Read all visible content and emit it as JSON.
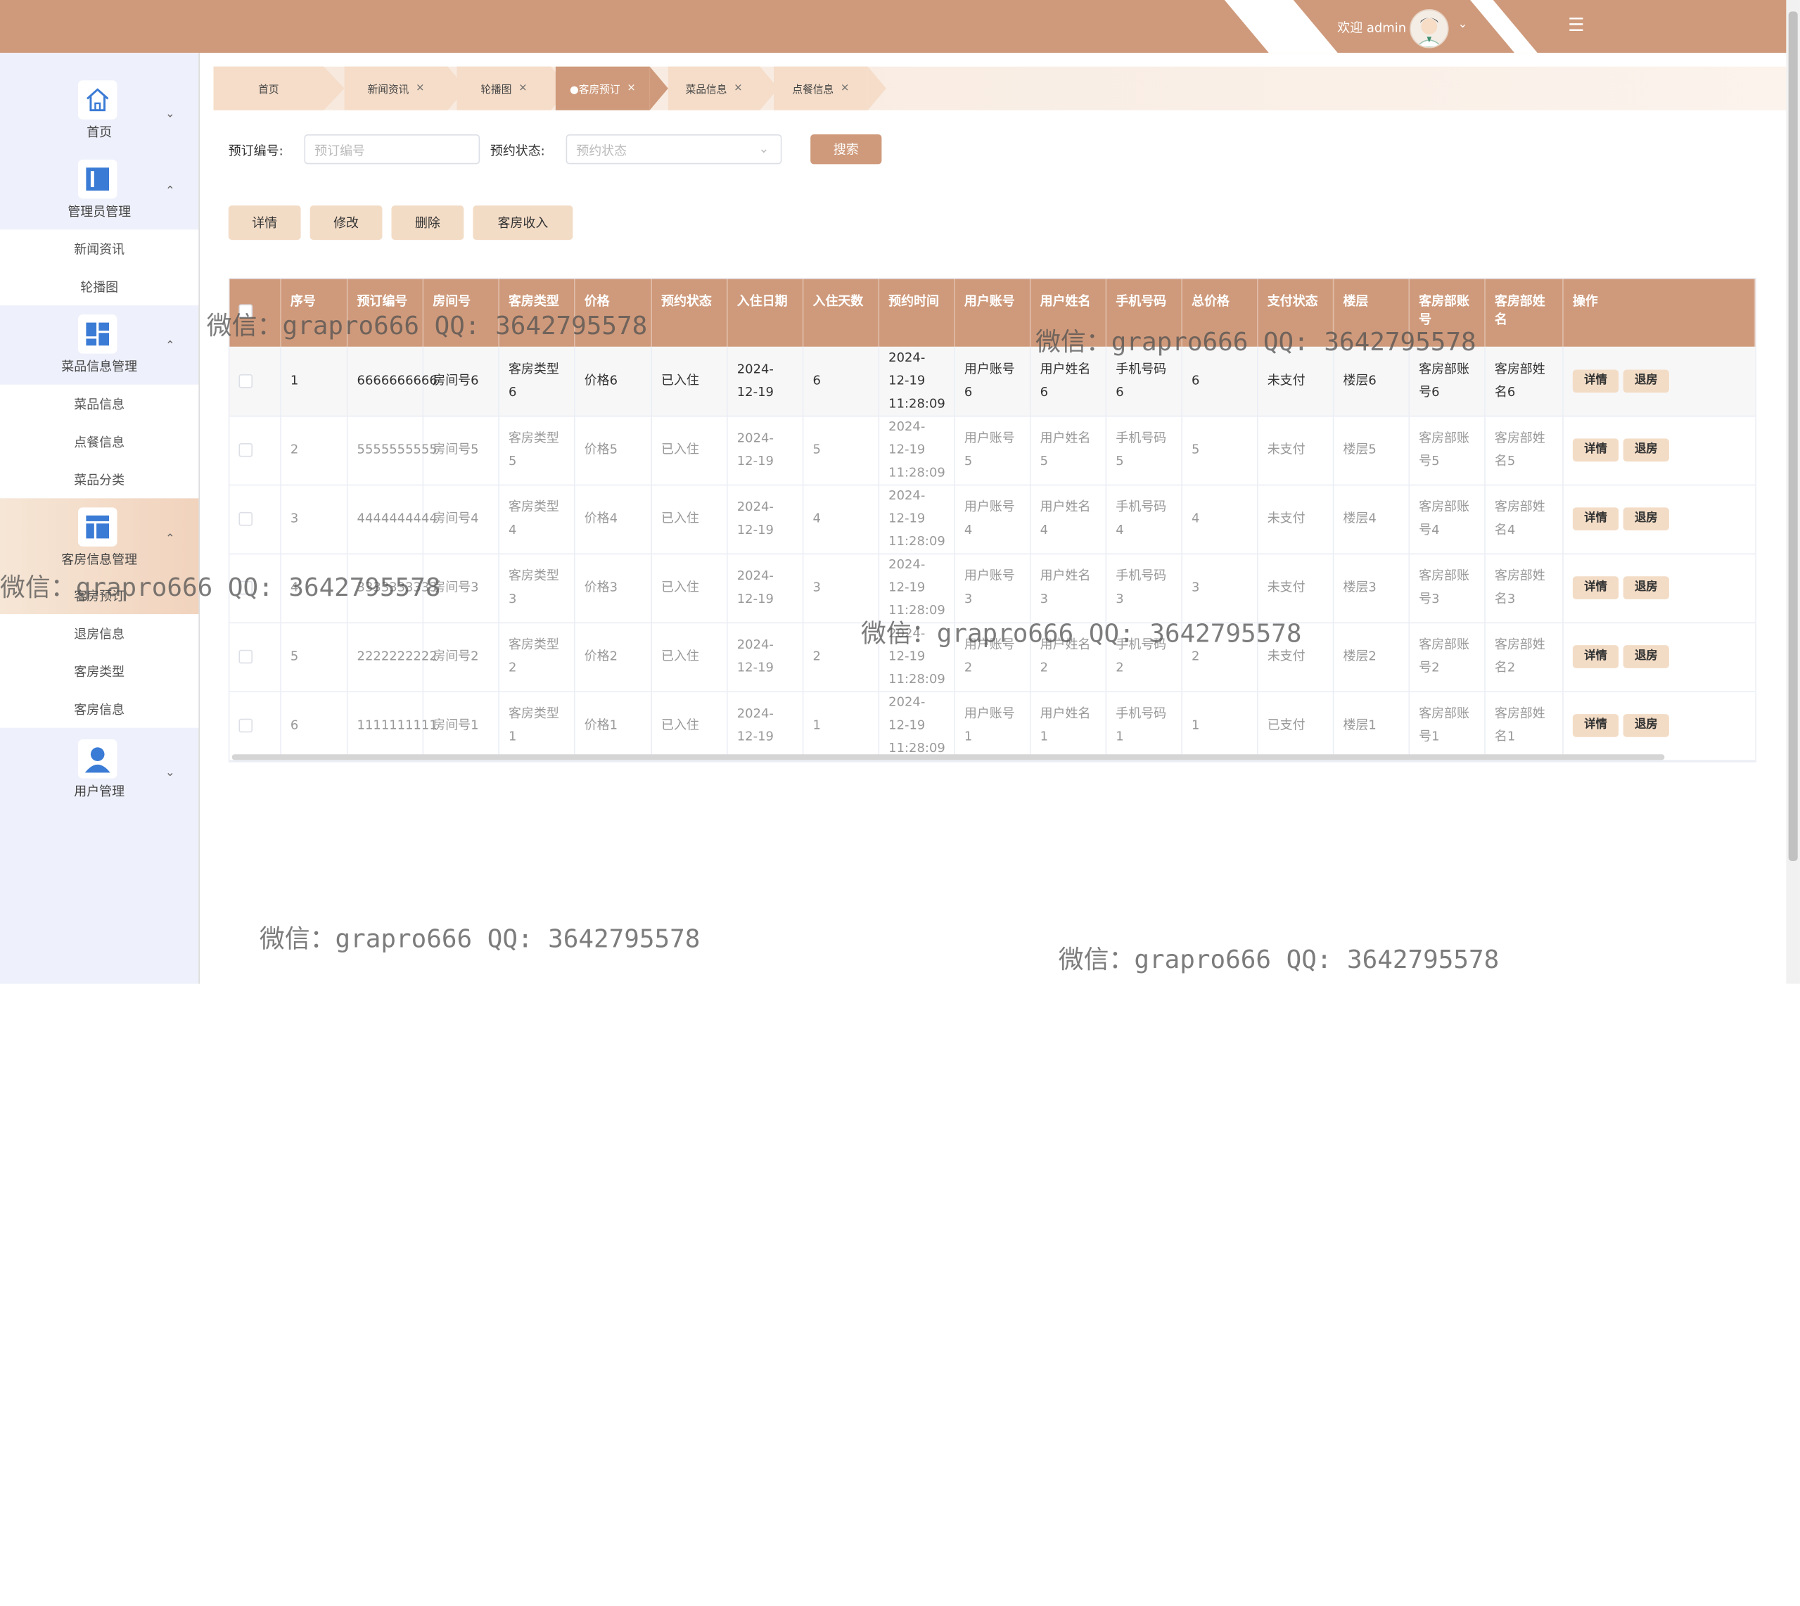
{
  "header": {
    "welcome": "欢迎 admin",
    "avatar_icon": "user-avatar-icon",
    "dropdown_icon": "chevron-down-icon",
    "menu_icon": "hamburger-icon"
  },
  "sidebar": {
    "groups": [
      {
        "label": "首页",
        "icon": "home-icon",
        "expanded": false
      },
      {
        "label": "管理员管理",
        "icon": "admin-icon",
        "expanded": true,
        "items": [
          "新闻资讯",
          "轮播图"
        ]
      },
      {
        "label": "菜品信息管理",
        "icon": "grid-icon",
        "expanded": true,
        "items": [
          "菜品信息",
          "点餐信息",
          "菜品分类"
        ]
      },
      {
        "label": "客房信息管理",
        "icon": "layout-icon",
        "expanded": true,
        "items": [
          "客房预订",
          "退房信息",
          "客房类型",
          "客房信息"
        ]
      },
      {
        "label": "用户管理",
        "icon": "user-icon",
        "expanded": false
      }
    ]
  },
  "tabs": [
    {
      "label": "首页",
      "closable": false
    },
    {
      "label": "新闻资讯",
      "closable": true
    },
    {
      "label": "轮播图",
      "closable": true
    },
    {
      "label": "●客房预订",
      "closable": true,
      "active": true
    },
    {
      "label": "菜品信息",
      "closable": true
    },
    {
      "label": "点餐信息",
      "closable": true
    }
  ],
  "tab_close_symbol": "×",
  "search": {
    "order_label": "预订编号:",
    "order_placeholder": "预订编号",
    "status_label": "预约状态:",
    "status_placeholder": "预约状态",
    "search_button": "搜索"
  },
  "actions": [
    "详情",
    "修改",
    "删除",
    "客房收入"
  ],
  "table": {
    "columns": [
      "序号",
      "预订编号",
      "房间号",
      "客房类型",
      "价格",
      "预约状态",
      "入住日期",
      "入住天数",
      "预约时间",
      "用户账号",
      "用户姓名",
      "手机号码",
      "总价格",
      "支付状态",
      "楼层",
      "客房部账号",
      "客房部姓名",
      "操作"
    ],
    "rows": [
      [
        "1",
        "6666666666",
        "房间号6",
        "客房类型6",
        "价格6",
        "已入住",
        "2024-12-19",
        "6",
        "2024-12-19 11:28:09",
        "用户账号6",
        "用户姓名6",
        "手机号码6",
        "6",
        "未支付",
        "楼层6",
        "客房部账号6",
        "客房部姓名6"
      ],
      [
        "2",
        "5555555555",
        "房间号5",
        "客房类型5",
        "价格5",
        "已入住",
        "2024-12-19",
        "5",
        "2024-12-19 11:28:09",
        "用户账号5",
        "用户姓名5",
        "手机号码5",
        "5",
        "未支付",
        "楼层5",
        "客房部账号5",
        "客房部姓名5"
      ],
      [
        "3",
        "4444444444",
        "房间号4",
        "客房类型4",
        "价格4",
        "已入住",
        "2024-12-19",
        "4",
        "2024-12-19 11:28:09",
        "用户账号4",
        "用户姓名4",
        "手机号码4",
        "4",
        "未支付",
        "楼层4",
        "客房部账号4",
        "客房部姓名4"
      ],
      [
        "4",
        "3333333333",
        "房间号3",
        "客房类型3",
        "价格3",
        "已入住",
        "2024-12-19",
        "3",
        "2024-12-19 11:28:09",
        "用户账号3",
        "用户姓名3",
        "手机号码3",
        "3",
        "未支付",
        "楼层3",
        "客房部账号3",
        "客房部姓名3"
      ],
      [
        "5",
        "2222222222",
        "房间号2",
        "客房类型2",
        "价格2",
        "已入住",
        "2024-12-19",
        "2",
        "2024-12-19 11:28:09",
        "用户账号2",
        "用户姓名2",
        "手机号码2",
        "2",
        "未支付",
        "楼层2",
        "客房部账号2",
        "客房部姓名2"
      ],
      [
        "6",
        "1111111111",
        "房间号1",
        "客房类型1",
        "价格1",
        "已入住",
        "2024-12-19",
        "1",
        "2024-12-19 11:28:09",
        "用户账号1",
        "用户姓名1",
        "手机号码1",
        "1",
        "已支付",
        "楼层1",
        "客房部账号1",
        "客房部姓名1"
      ]
    ],
    "row_buttons": [
      "详情",
      "退房"
    ]
  },
  "watermark": "微信：grapro666 QQ: 3642795578",
  "colors": {
    "accent": "#cf9a7b",
    "accent_light": "#f3dcc6",
    "sidebar_bg": "#eef0fb"
  }
}
